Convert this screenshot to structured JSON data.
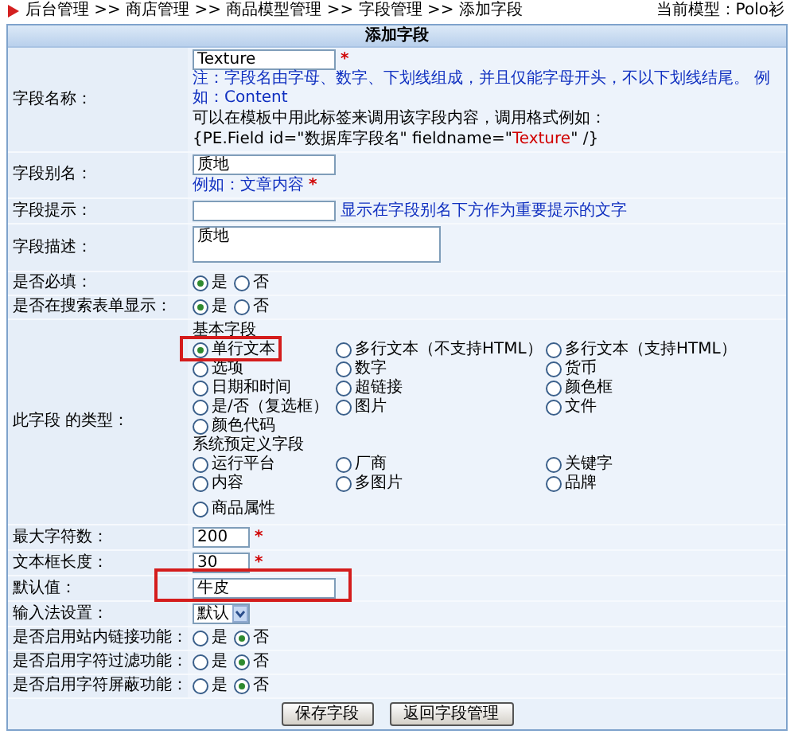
{
  "breadcrumb": {
    "path": "后台管理 >> 商店管理 >> 商品模型管理 >> 字段管理 >> 添加字段",
    "current_model": "当前模型：Polo衫"
  },
  "form": {
    "title": "添加字段",
    "rows": [
      {
        "kind": "text",
        "label": "字段名称：",
        "value": "Texture",
        "mark": "*",
        "highlighted": false,
        "notes": [
          {
            "kind": "info",
            "text": "注：字段名由字母、数字、下划线组成，并且仅能字母开头，不以下划线结尾。 例如：Content"
          },
          {
            "kind": "plain",
            "text": "可以在模板中用此标签来调用该字段内容，调用格式例如："
          },
          {
            "kind": "code",
            "before": "{PE.Field id=\"数据库字段名\" fieldname=\"",
            "highlight": "Texture",
            "after": "\" /}"
          }
        ]
      },
      {
        "kind": "text",
        "label": "字段别名：",
        "value": "质地",
        "highlighted": false,
        "notes": [
          {
            "kind": "info",
            "text": "例如：文章内容",
            "mark": "*"
          }
        ]
      },
      {
        "kind": "text",
        "label": "字段提示：",
        "value": "",
        "highlighted": false,
        "inline_note": "显示在字段别名下方作为重要提示的文字"
      },
      {
        "kind": "textarea",
        "label": "字段描述：",
        "value": "质地",
        "highlighted": false
      },
      {
        "kind": "radio",
        "label": "是否必填：",
        "highlighted": false,
        "options": [
          {
            "label": "是",
            "selected": true
          },
          {
            "label": "否",
            "selected": false
          }
        ]
      },
      {
        "kind": "radio",
        "label": "是否在搜索表单显示：",
        "highlighted": false,
        "options": [
          {
            "label": "是",
            "selected": true
          },
          {
            "label": "否",
            "selected": false
          }
        ]
      },
      {
        "kind": "type",
        "label": "此字段 的类型：",
        "highlighted": false,
        "groups": [
          {
            "title": "基本字段",
            "options": [
              {
                "label": "单行文本",
                "selected": true,
                "highlighted": true
              },
              {
                "label": "多行文本（不支持HTML）",
                "selected": false,
                "highlighted": false
              },
              {
                "label": "多行文本（支持HTML）",
                "selected": false,
                "highlighted": false
              },
              {
                "label": "选项",
                "selected": false,
                "highlighted": false
              },
              {
                "label": "数字",
                "selected": false,
                "highlighted": false
              },
              {
                "label": "货币",
                "selected": false,
                "highlighted": false
              },
              {
                "label": "日期和时间",
                "selected": false,
                "highlighted": false
              },
              {
                "label": "超链接",
                "selected": false,
                "highlighted": false
              },
              {
                "label": "颜色框",
                "selected": false,
                "highlighted": false
              },
              {
                "label": "是/否（复选框）",
                "selected": false,
                "highlighted": false
              },
              {
                "label": "图片",
                "selected": false,
                "highlighted": false
              },
              {
                "label": "文件",
                "selected": false,
                "highlighted": false
              },
              {
                "label": "颜色代码",
                "selected": false,
                "highlighted": false
              }
            ]
          },
          {
            "title": "系统预定义字段",
            "options": [
              {
                "label": "运行平台",
                "selected": false,
                "highlighted": false
              },
              {
                "label": "厂商",
                "selected": false,
                "highlighted": false
              },
              {
                "label": "关键字",
                "selected": false,
                "highlighted": false
              },
              {
                "label": "内容",
                "selected": false,
                "highlighted": false
              },
              {
                "label": "多图片",
                "selected": false,
                "highlighted": false
              },
              {
                "label": "品牌",
                "selected": false,
                "highlighted": false
              }
            ]
          },
          {
            "options": [
              {
                "label": "商品属性",
                "selected": false,
                "highlighted": false
              }
            ]
          }
        ]
      },
      {
        "kind": "number",
        "label": "最大字符数：",
        "value": "200",
        "mark": "*",
        "highlighted": false
      },
      {
        "kind": "number",
        "label": "文本框长度：",
        "value": "30",
        "mark": "*",
        "highlighted": false
      },
      {
        "kind": "text",
        "label": "默认值：",
        "value": "牛皮",
        "highlighted": true
      },
      {
        "kind": "select",
        "label": "输入法设置：",
        "value": "默认",
        "highlighted": false
      },
      {
        "kind": "radio",
        "label": "是否启用站内链接功能：",
        "highlighted": false,
        "options": [
          {
            "label": "是",
            "selected": false
          },
          {
            "label": "否",
            "selected": true
          }
        ]
      },
      {
        "kind": "radio",
        "label": "是否启用字符过滤功能：",
        "highlighted": false,
        "options": [
          {
            "label": "是",
            "selected": false
          },
          {
            "label": "否",
            "selected": true
          }
        ]
      },
      {
        "kind": "radio",
        "label": "是否启用字符屏蔽功能：",
        "highlighted": false,
        "options": [
          {
            "label": "是",
            "selected": false
          },
          {
            "label": "否",
            "selected": true
          }
        ]
      }
    ],
    "buttons": [
      "保存字段",
      "返回字段管理"
    ]
  }
}
